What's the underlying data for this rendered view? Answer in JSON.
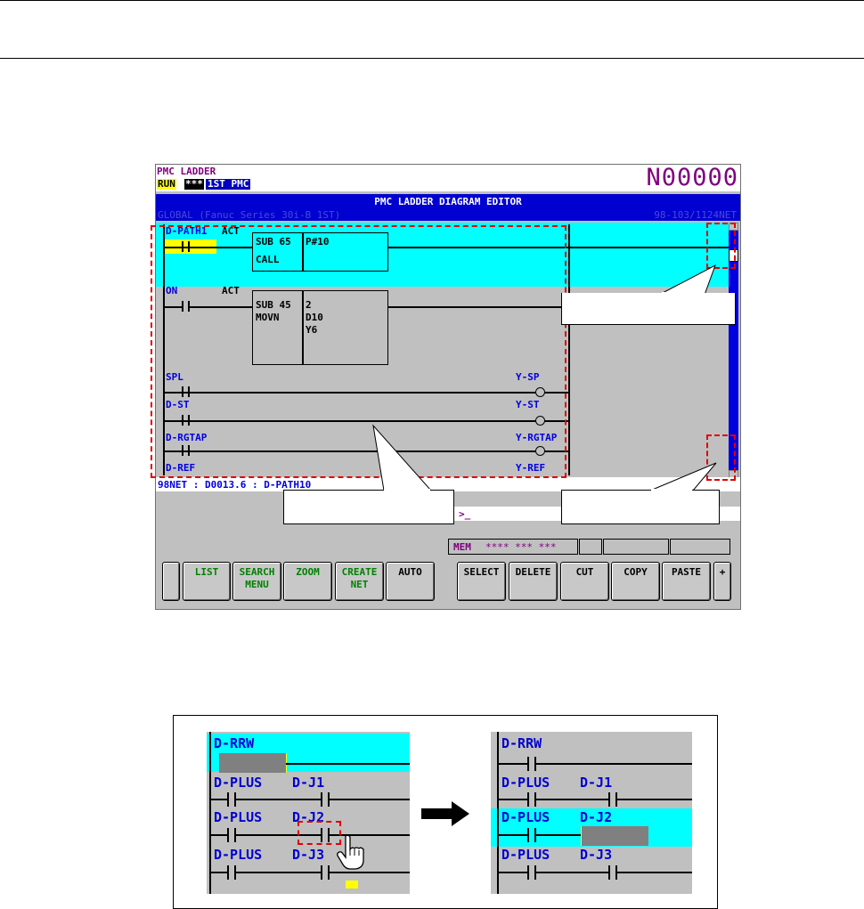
{
  "screen": {
    "title": "PMC LADDER",
    "status_run": "RUN",
    "status_stars": "***",
    "status_pmc": "1ST PMC",
    "program_number": "N00000",
    "editor_title": "PMC LADDER DIAGRAM EDITOR",
    "global_label": "GLOBAL (Fanuc Series 30i-B 1ST)",
    "net_counter": "98-103/1124NET",
    "rungs": {
      "r1_contact": "D-PATH1",
      "r1_act": "ACT",
      "r1_func": "SUB 65",
      "r1_func2": "CALL",
      "r1_param": "P#10",
      "r2_contact": "ON",
      "r2_act": "ACT",
      "r2_func": "SUB 45",
      "r2_func2": "MOVN",
      "r2_p1": "2",
      "r2_p2": "D10",
      "r2_p3": "Y6",
      "r3_contact": "SPL",
      "r3_coil": "Y-SP",
      "r4_contact": "D-ST",
      "r4_coil": "Y-ST",
      "r5_contact": "D-RGTAP",
      "r5_coil": "Y-RGTAP",
      "r6_contact": "D-REF",
      "r6_coil": "Y-REF"
    },
    "status_line": "98NET : D0013.6 : D-PATH10",
    "prompt": ">_",
    "mem_label": "MEM",
    "mem_stars": "**** *** ***",
    "softkeys": [
      "LIST",
      "SEARCH\nMENU",
      "ZOOM",
      "CREATE\nNET",
      "AUTO",
      "SELECT",
      "DELETE",
      "CUT",
      "COPY",
      "PASTE",
      "+"
    ]
  },
  "figure": {
    "left": {
      "r1": "D-RRW",
      "r2a": "D-PLUS",
      "r2b": "D-J1",
      "r3a": "D-PLUS",
      "r3b": "D-J2",
      "r4a": "D-PLUS",
      "r4b": "D-J3"
    },
    "right": {
      "r1": "D-RRW",
      "r2a": "D-PLUS",
      "r2b": "D-J1",
      "r3a": "D-PLUS",
      "r3b": "D-J2",
      "r4a": "D-PLUS",
      "r4b": "D-J3"
    }
  }
}
